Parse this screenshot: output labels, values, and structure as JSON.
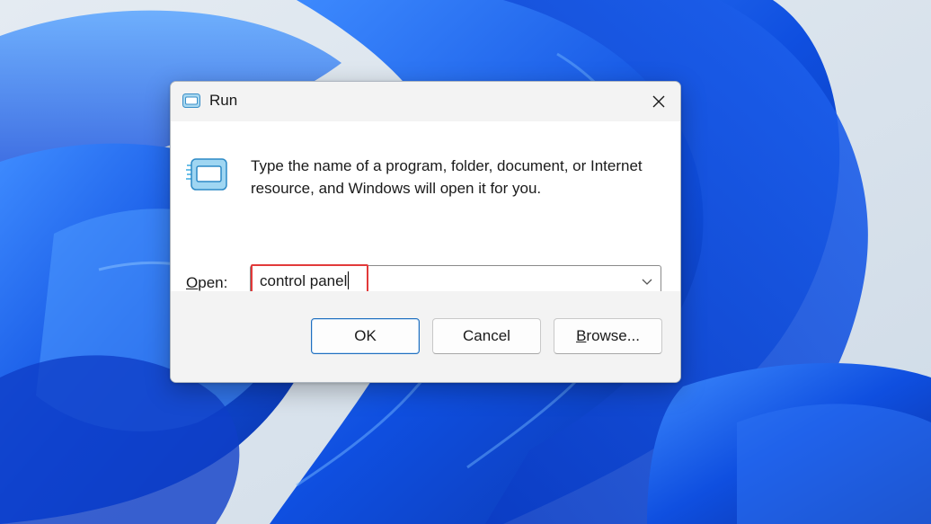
{
  "dialog": {
    "title": "Run",
    "description": "Type the name of a program, folder, document, or Internet resource, and Windows will open it for you.",
    "open_label": {
      "accel": "O",
      "rest": "pen:"
    },
    "input_value": "control panel",
    "buttons": {
      "ok": "OK",
      "cancel": "Cancel",
      "browse_accel": "B",
      "browse_rest": "rowse..."
    }
  },
  "icons": {
    "title": "run-icon",
    "content": "run-icon",
    "close": "close-icon",
    "dropdown": "chevron-down-icon"
  },
  "colors": {
    "highlight": "#e23a3a",
    "wallpaper_blue": "#1a57e8",
    "default_button_border": "#1f6fbf"
  }
}
